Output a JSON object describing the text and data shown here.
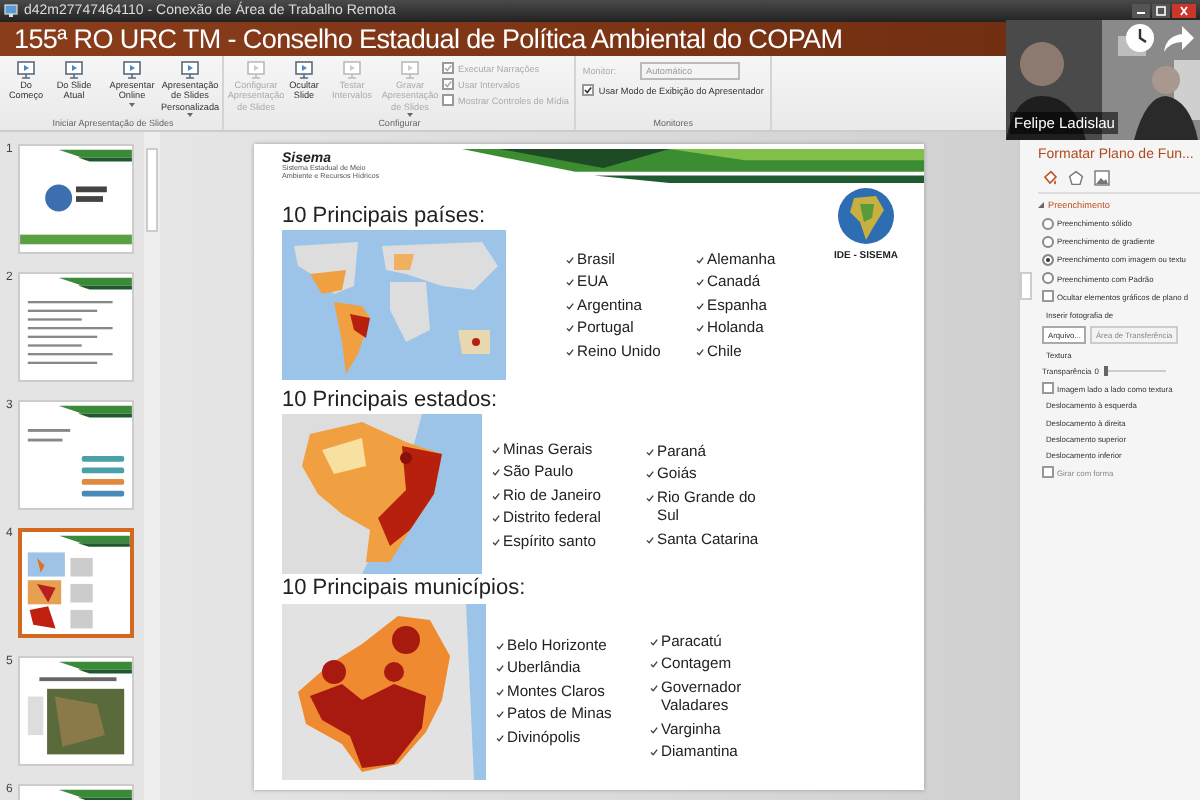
{
  "remote_window": {
    "title": "d42m27747464110 - Conexão de Área de Trabalho Remota"
  },
  "meeting_banner": {
    "title": "155ª RO URC TM - Conselho Estadual de Política Ambiental do COPAM"
  },
  "webcam": {
    "participant": "Felipe Ladislau",
    "video": {
      "kind": "picture"
    }
  },
  "ribbon": {
    "groups": [
      {
        "label": "Iniciar Apresentação de Slides",
        "items": [
          {
            "kind": "button",
            "label": "Do Começo",
            "disabled": false,
            "menu": false
          },
          {
            "kind": "button",
            "label": "Do Slide Atual",
            "disabled": false,
            "menu": false
          },
          {
            "kind": "button",
            "label": "Apresentar Online",
            "disabled": false,
            "menu": true
          },
          {
            "kind": "button",
            "label": "Apresentação de Slides Personalizada",
            "disabled": false,
            "menu": true
          }
        ]
      },
      {
        "label": "Configurar",
        "items": [
          {
            "kind": "button",
            "label": "Configurar Apresentação de Slides",
            "disabled": true,
            "menu": false
          },
          {
            "kind": "button",
            "label": "Ocultar Slide",
            "disabled": false,
            "menu": false
          },
          {
            "kind": "button",
            "label": "Testar Intervalos",
            "disabled": true,
            "menu": false
          },
          {
            "kind": "button",
            "label": "Gravar Apresentação de Slides",
            "disabled": true,
            "menu": true
          },
          {
            "kind": "options",
            "rows": [
              {
                "kind": "checkbox",
                "label": "Executar Narrações",
                "checked": true,
                "disabled": true
              },
              {
                "kind": "checkbox",
                "label": "Usar Intervalos",
                "checked": true,
                "disabled": true
              },
              {
                "kind": "checkbox",
                "label": "Mostrar Controles de Mídia",
                "checked": false,
                "disabled": true
              }
            ]
          }
        ]
      },
      {
        "label": "Monitores",
        "items": [
          {
            "kind": "options",
            "rows": [
              {
                "kind": "dropdown",
                "label": "Monitor:",
                "value": "Automático",
                "disabled": true
              },
              {
                "kind": "checkbox",
                "label": "Usar Modo de Exibição do Apresentador",
                "checked": true,
                "disabled": false
              }
            ]
          }
        ]
      }
    ]
  },
  "thumbnails": [
    {
      "number": "1",
      "selected": false
    },
    {
      "number": "2",
      "selected": false
    },
    {
      "number": "3",
      "selected": false
    },
    {
      "number": "4",
      "selected": true
    },
    {
      "number": "5",
      "selected": false
    },
    {
      "number": "6",
      "selected": false
    }
  ],
  "slide": {
    "brand": {
      "name": "Sisema",
      "subtitle": "Sistema Estadual de Meio Ambiente e Recursos Hídricos"
    },
    "logo": {
      "caption": "IDE - SISEMA"
    },
    "sections": [
      {
        "title": "10 Principais países:",
        "map": {
          "kind": "picture"
        },
        "columns": [
          [
            "Brasil",
            "EUA",
            "Argentina",
            "Portugal",
            "Reino Unido"
          ],
          [
            "Alemanha",
            "Canadá",
            "Espanha",
            "Holanda",
            "Chile"
          ]
        ]
      },
      {
        "title": "10 Principais estados:",
        "map": {
          "kind": "picture"
        },
        "columns": [
          [
            "Minas Gerais",
            "São Paulo",
            "Rio de Janeiro",
            "Distrito federal",
            "Espírito santo"
          ],
          [
            "Paraná",
            "Goiás",
            "Rio Grande do Sul",
            "Santa Catarina"
          ]
        ]
      },
      {
        "title": "10 Principais municípios:",
        "map": {
          "kind": "picture"
        },
        "columns": [
          [
            "Belo Horizonte",
            "Uberlândia",
            "Montes Claros",
            "Patos de Minas",
            "Divinópolis"
          ],
          [
            "Paracatú",
            "Contagem",
            "Governador Valadares",
            "Varginha",
            "Diamantina"
          ]
        ]
      }
    ]
  },
  "format_pane": {
    "title": "Formatar Plano de Fun...",
    "section": {
      "label": "Preenchimento",
      "expanded": true
    },
    "options": [
      {
        "kind": "radio",
        "label": "Preenchimento sólido",
        "selected": false
      },
      {
        "kind": "radio",
        "label": "Preenchimento de gradiente",
        "selected": false
      },
      {
        "kind": "radio",
        "label": "Preenchimento com imagem ou textu",
        "selected": true
      },
      {
        "kind": "radio",
        "label": "Preenchimento com Padrão",
        "selected": false
      },
      {
        "kind": "checkbox",
        "label": "Ocultar elementos gráficos de plano d",
        "checked": false,
        "disabled": false
      },
      {
        "kind": "label",
        "label": "Inserir fotografia de"
      },
      {
        "kind": "buttons",
        "buttons": [
          {
            "label": "Arquivo...",
            "disabled": false
          },
          {
            "label": "Área de Transferência",
            "disabled": true
          }
        ]
      },
      {
        "kind": "label",
        "label": "Textura"
      },
      {
        "kind": "slider",
        "label": "Transparência",
        "value": "0",
        "level": 0
      },
      {
        "kind": "checkbox",
        "label": "Imagem lado a lado como textura",
        "checked": false,
        "disabled": false
      },
      {
        "kind": "label",
        "label": "Deslocamento à esquerda"
      },
      {
        "kind": "label",
        "label": "Deslocamento à direita"
      },
      {
        "kind": "label",
        "label": "Deslocamento superior"
      },
      {
        "kind": "label",
        "label": "Deslocamento inferior"
      },
      {
        "kind": "checkbox",
        "label": "Girar com forma",
        "checked": false,
        "disabled": true
      }
    ]
  }
}
